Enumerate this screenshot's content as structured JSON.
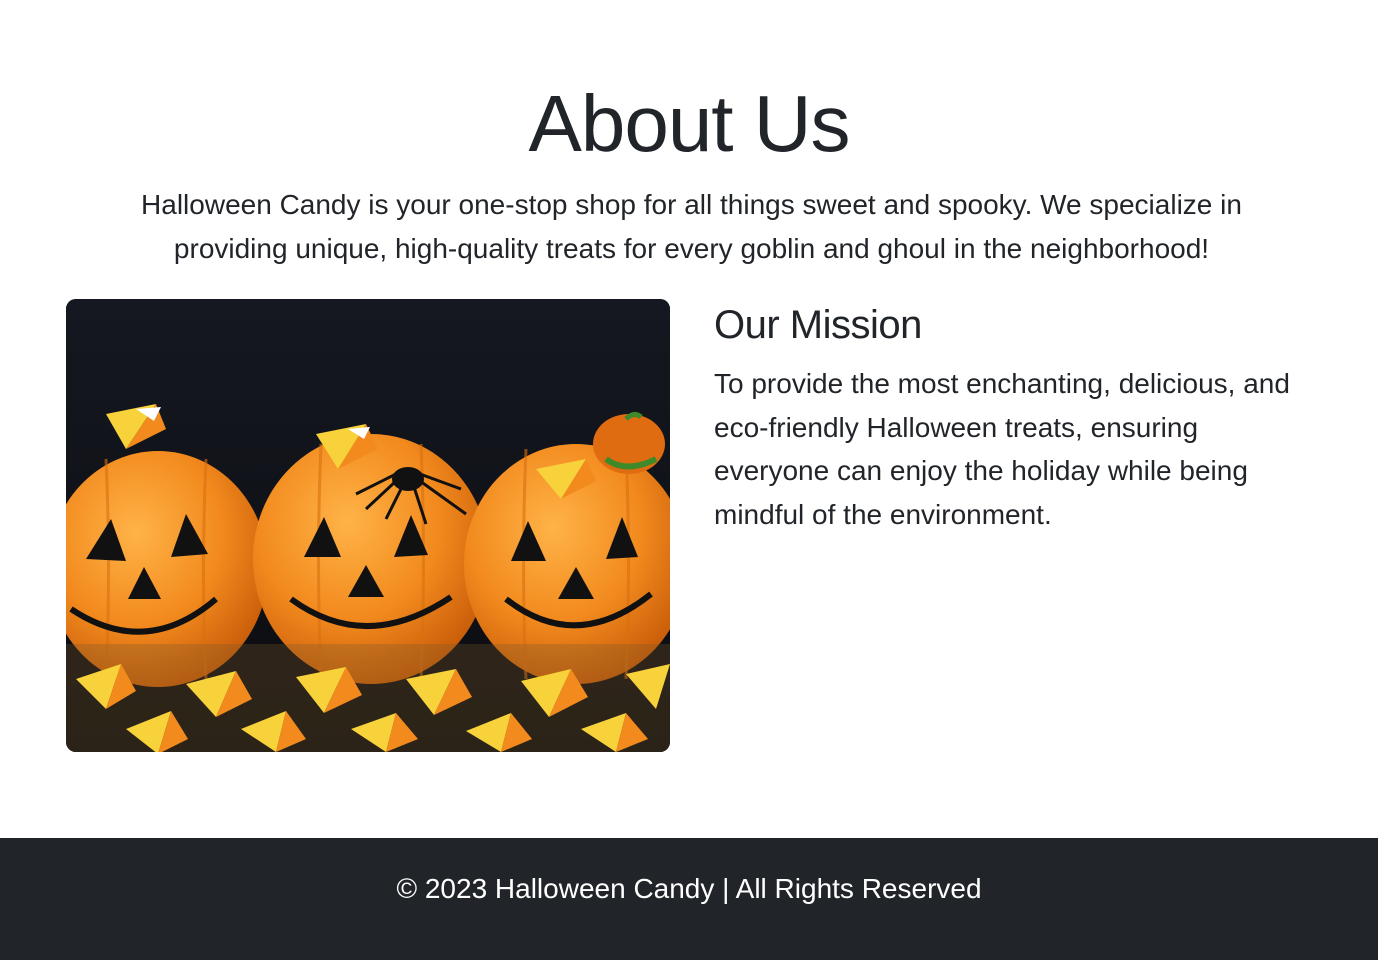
{
  "about": {
    "title": "About Us",
    "intro": "Halloween Candy is your one-stop shop for all things sweet and spooky. We specialize in providing unique, high-quality treats for every goblin and ghoul in the neighborhood!"
  },
  "mission": {
    "title": "Our Mission",
    "text": "To provide the most enchanting, delicious, and eco-friendly Halloween treats, ensuring everyone can enjoy the holiday while being mindful of the environment."
  },
  "footer": {
    "text": "© 2023 Halloween Candy | All Rights Reserved"
  },
  "colors": {
    "text": "#212529",
    "footer_bg": "#212529",
    "footer_text": "#ffffff",
    "pumpkin_orange": "#f28a1e",
    "candy_yellow": "#f7d23a"
  }
}
